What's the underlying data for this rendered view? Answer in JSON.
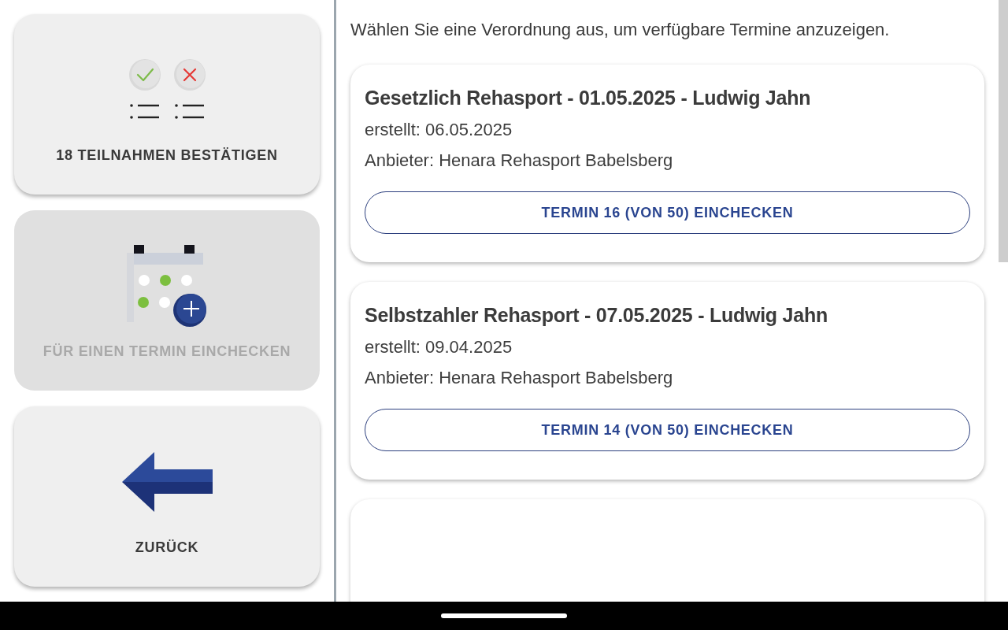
{
  "side_actions": [
    {
      "kind": "confirm",
      "label": "18 TEILNAHMEN BESTÄTIGEN",
      "disabled": false
    },
    {
      "kind": "checkin",
      "label": "FÜR EINEN TERMIN EINCHECKEN",
      "disabled": true
    },
    {
      "kind": "back",
      "label": "ZURÜCK",
      "disabled": false
    }
  ],
  "intro": "Wählen Sie eine Verordnung aus, um verfügbare Termine anzuzeigen.",
  "prescriptions": [
    {
      "kind": "full",
      "title": "Gesetzlich Rehasport - 01.05.2025 - Ludwig Jahn",
      "created": "erstellt: 06.05.2025",
      "provider": "Anbieter: Henara Rehasport Babelsberg",
      "button": "TERMIN 16 (VON 50) EINCHECKEN"
    },
    {
      "kind": "full",
      "title": "Selbstzahler Rehasport - 07.05.2025 - Ludwig Jahn",
      "created": "erstellt: 09.04.2025",
      "provider": "Anbieter: Henara Rehasport Babelsberg",
      "button": "TERMIN 14 (VON 50) EINCHECKEN"
    },
    {
      "kind": "partial"
    }
  ]
}
